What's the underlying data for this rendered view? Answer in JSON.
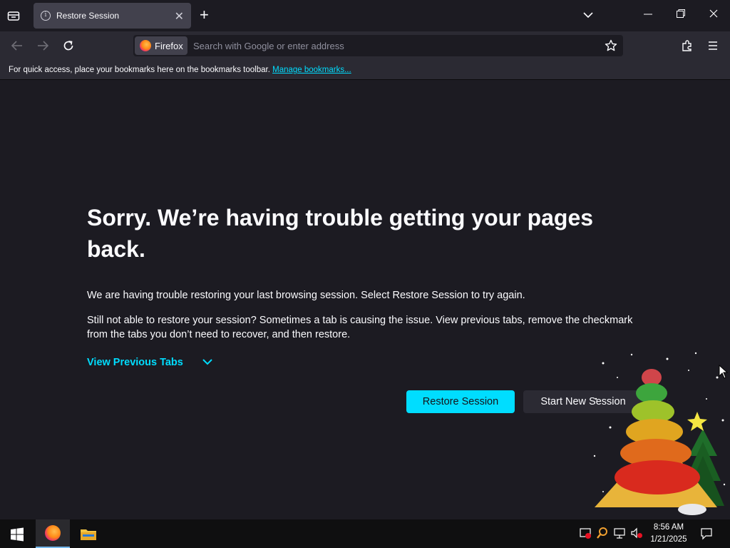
{
  "tab": {
    "title": "Restore Session"
  },
  "urlbar": {
    "identity_label": "Firefox",
    "placeholder": "Search with Google or enter address"
  },
  "bookmarks": {
    "text": "For quick access, place your bookmarks here on the bookmarks toolbar.",
    "link": "Manage bookmarks..."
  },
  "content": {
    "headline": "Sorry. We’re having trouble getting your pages back.",
    "para1": "We are having trouble restoring your last browsing session. Select Restore Session to try again.",
    "para2": "Still not able to restore your session? Sometimes a tab is causing the issue. View previous tabs, remove the checkmark from the tabs you don’t need to recover, and then restore.",
    "view_previous": "View Previous Tabs",
    "restore_button": "Restore Session",
    "new_session_button": "Start New Session"
  },
  "taskbar": {
    "time": "8:56 AM",
    "date": "1/21/2025"
  },
  "colors": {
    "accent": "#00ddff",
    "background": "#1c1b22",
    "toolbar": "#2b2a33"
  }
}
